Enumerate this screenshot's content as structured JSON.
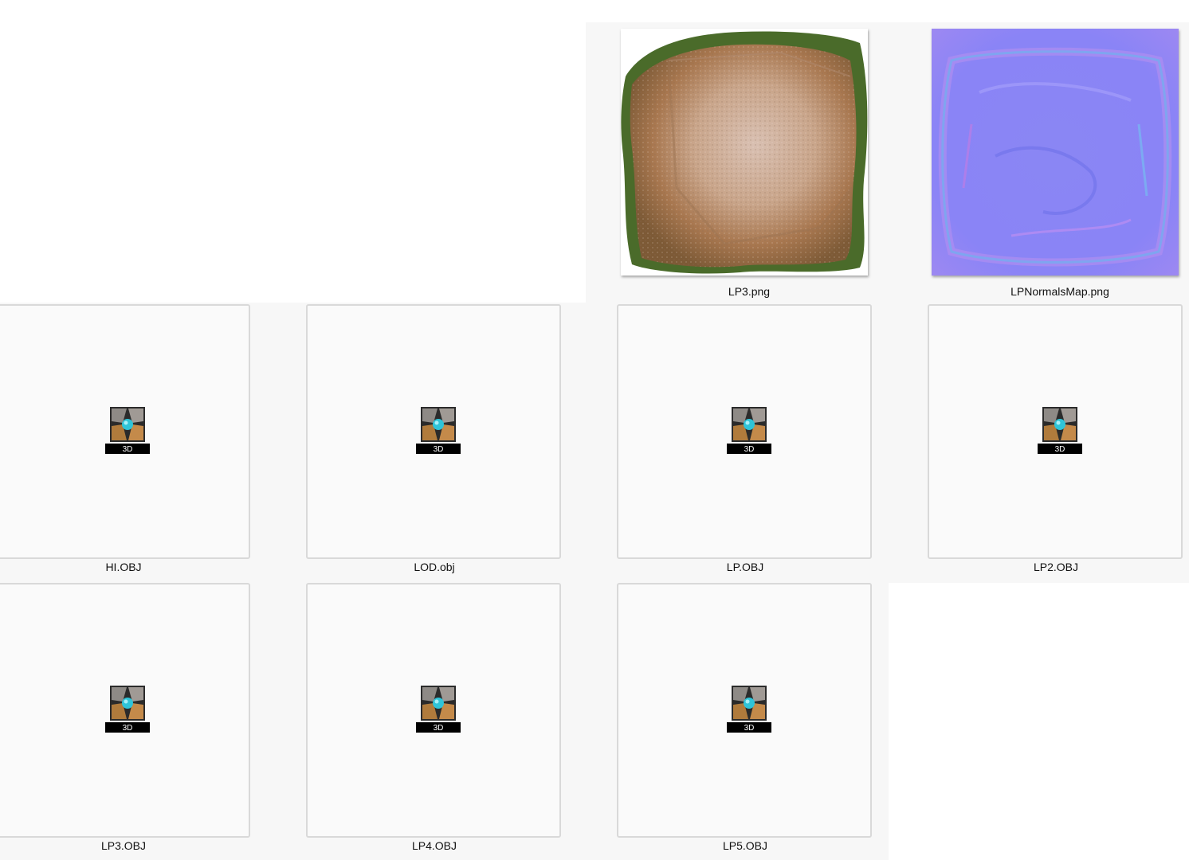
{
  "explorer": {
    "files": [
      {
        "name": "LP3.png",
        "kind": "image",
        "preview": "rock-texture",
        "selected": false
      },
      {
        "name": "LPNormalsMap.png",
        "kind": "image",
        "preview": "normal-map",
        "selected": false
      },
      {
        "name": "HI.OBJ",
        "kind": "3d-object",
        "icon": "3d-object-icon",
        "icon_badge": "3D"
      },
      {
        "name": "LOD.obj",
        "kind": "3d-object",
        "icon": "3d-object-icon",
        "icon_badge": "3D"
      },
      {
        "name": "LP.OBJ",
        "kind": "3d-object",
        "icon": "3d-object-icon",
        "icon_badge": "3D"
      },
      {
        "name": "LP2.OBJ",
        "kind": "3d-object",
        "icon": "3d-object-icon",
        "icon_badge": "3D"
      },
      {
        "name": "LP3.OBJ",
        "kind": "3d-object",
        "icon": "3d-object-icon",
        "icon_badge": "3D"
      },
      {
        "name": "LP4.OBJ",
        "kind": "3d-object",
        "icon": "3d-object-icon",
        "icon_badge": "3D"
      },
      {
        "name": "LP5.OBJ",
        "kind": "3d-object",
        "icon": "3d-object-icon",
        "icon_badge": "3D"
      }
    ]
  },
  "colors": {
    "background": "#ffffff",
    "tile_fill": "#fafafa",
    "tile_border": "#d9d9d9",
    "normal_map_base": "#8080ff",
    "badge": "#000000",
    "icon_gem": "#2fc4d8"
  }
}
